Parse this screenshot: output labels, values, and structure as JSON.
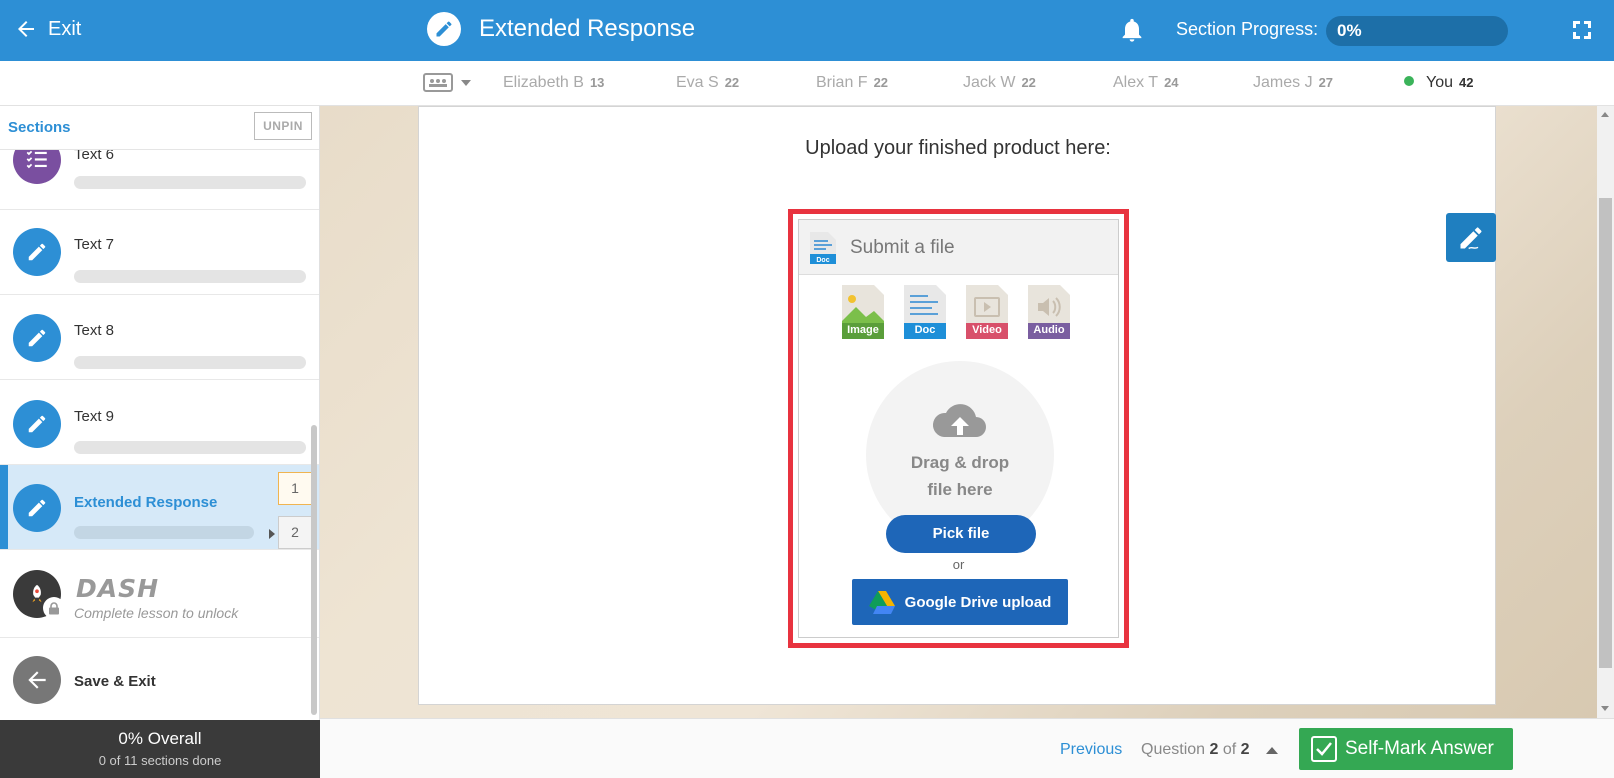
{
  "header": {
    "exit_label": "Exit",
    "title": "Extended Response",
    "progress_label": "Section Progress:",
    "progress_value": "0%",
    "progress_fraction": 0,
    "accent_color": "#2d8fd5"
  },
  "leaderboard": {
    "entries": [
      {
        "name": "Elizabeth B",
        "score": "13"
      },
      {
        "name": "Eva S",
        "score": "22"
      },
      {
        "name": "Brian F",
        "score": "22"
      },
      {
        "name": "Jack W",
        "score": "22"
      },
      {
        "name": "Alex T",
        "score": "24"
      },
      {
        "name": "James J",
        "score": "27"
      }
    ],
    "you": {
      "name": "You",
      "score": "42"
    }
  },
  "sidebar": {
    "label": "Sections",
    "unpin_label": "UNPIN",
    "items": [
      {
        "title": "Text 6",
        "icon": "checklist-icon",
        "color": "#7a4fa0"
      },
      {
        "title": "Text 7",
        "icon": "pencil-icon",
        "color": "#2d8fd5"
      },
      {
        "title": "Text 8",
        "icon": "pencil-icon",
        "color": "#2d8fd5"
      },
      {
        "title": "Text 9",
        "icon": "pencil-icon",
        "color": "#2d8fd5"
      },
      {
        "title": "Extended Response",
        "icon": "pencil-icon",
        "color": "#2d8fd5",
        "active": true
      }
    ],
    "question_numbers": [
      "1",
      "2"
    ],
    "dash": {
      "title": "DASH",
      "subtitle": "Complete lesson to unlock"
    },
    "save_exit_label": "Save & Exit"
  },
  "overall": {
    "title": "0% Overall",
    "subtitle": "0 of 11 sections done"
  },
  "main": {
    "heading": "Upload your finished product here:",
    "widget": {
      "title": "Submit a file",
      "file_types": [
        {
          "label": "Image",
          "color": "#5a9e3a"
        },
        {
          "label": "Doc",
          "color": "#1e8fd8"
        },
        {
          "label": "Video",
          "color": "#d8506a"
        },
        {
          "label": "Audio",
          "color": "#7a5ea0"
        }
      ],
      "drop_line1": "Drag & drop",
      "drop_line2": "file here",
      "pick_label": "Pick file",
      "or_label": "or",
      "gdrive_label": "Google Drive upload"
    }
  },
  "footer": {
    "previous_label": "Previous",
    "question_prefix": "Question",
    "question_current": "2",
    "question_of": "of",
    "question_total": "2",
    "self_mark_label": "Self-Mark Answer"
  }
}
